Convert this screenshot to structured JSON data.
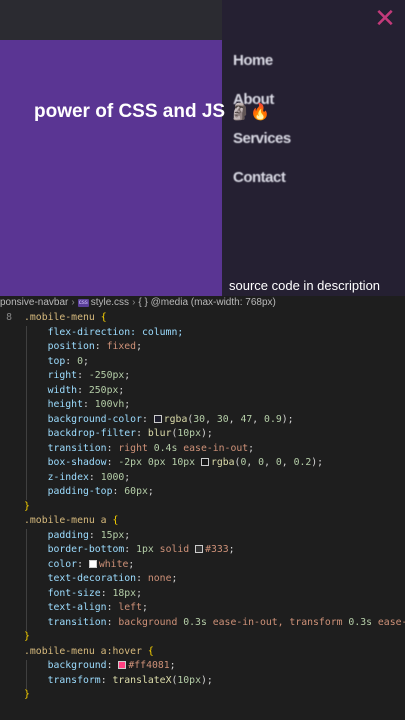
{
  "preview": {
    "menu_items": [
      "Home",
      "About",
      "Services",
      "Contact"
    ],
    "close_glyph": "✕",
    "caption": "power of CSS and JS",
    "caption_emojis": [
      "🗿",
      "🔥"
    ],
    "source_note": "source code in description"
  },
  "breadcrumb": {
    "folder": "ponsive-navbar",
    "file_badge": "css",
    "file": "style.css",
    "symbol": "{ } @media (max-width: 768px)"
  },
  "colors": {
    "purple_panel": "#5a3593",
    "menu_panel": "#252032",
    "close_icon": "#c33a7a"
  },
  "code": {
    "line_number_glyph": "8",
    "lines": [
      [
        {
          "t": ".mobile-menu ",
          "c": "sel"
        },
        {
          "t": "{",
          "c": "brace"
        }
      ],
      [
        {
          "t": "    flex-direction: column;",
          "c": "prop"
        }
      ],
      [
        {
          "t": "    position",
          "c": "prop"
        },
        {
          "t": ": ",
          "c": "punc"
        },
        {
          "t": "fixed",
          "c": "val"
        },
        {
          "t": ";",
          "c": "punc"
        }
      ],
      [
        {
          "t": "    top",
          "c": "prop"
        },
        {
          "t": ": ",
          "c": "punc"
        },
        {
          "t": "0",
          "c": "num"
        },
        {
          "t": ";",
          "c": "punc"
        }
      ],
      [
        {
          "t": "    right",
          "c": "prop"
        },
        {
          "t": ": ",
          "c": "punc"
        },
        {
          "t": "-250px",
          "c": "num"
        },
        {
          "t": ";",
          "c": "punc"
        }
      ],
      [
        {
          "t": "    width",
          "c": "prop"
        },
        {
          "t": ": ",
          "c": "punc"
        },
        {
          "t": "250px",
          "c": "num"
        },
        {
          "t": ";",
          "c": "punc"
        }
      ],
      [
        {
          "t": "    height",
          "c": "prop"
        },
        {
          "t": ": ",
          "c": "punc"
        },
        {
          "t": "100vh",
          "c": "num"
        },
        {
          "t": ";",
          "c": "punc"
        }
      ],
      [
        {
          "t": "    background-color",
          "c": "prop"
        },
        {
          "t": ": ",
          "c": "punc"
        },
        {
          "sw": "rgba(30,30,47,0.9)"
        },
        {
          "t": "rgba",
          "c": "fn"
        },
        {
          "t": "(",
          "c": "punc"
        },
        {
          "t": "30",
          "c": "num"
        },
        {
          "t": ", ",
          "c": "punc"
        },
        {
          "t": "30",
          "c": "num"
        },
        {
          "t": ", ",
          "c": "punc"
        },
        {
          "t": "47",
          "c": "num"
        },
        {
          "t": ", ",
          "c": "punc"
        },
        {
          "t": "0.9",
          "c": "num"
        },
        {
          "t": ");",
          "c": "punc"
        }
      ],
      [
        {
          "t": "    backdrop-filter",
          "c": "prop"
        },
        {
          "t": ": ",
          "c": "punc"
        },
        {
          "t": "blur",
          "c": "fn"
        },
        {
          "t": "(",
          "c": "punc"
        },
        {
          "t": "10px",
          "c": "num"
        },
        {
          "t": ");",
          "c": "punc"
        }
      ],
      [
        {
          "t": "    transition",
          "c": "prop"
        },
        {
          "t": ": ",
          "c": "punc"
        },
        {
          "t": "right ",
          "c": "val"
        },
        {
          "t": "0.4s",
          "c": "num"
        },
        {
          "t": " ease-in-out",
          "c": "val"
        },
        {
          "t": ";",
          "c": "punc"
        }
      ],
      [
        {
          "t": "    box-shadow",
          "c": "prop"
        },
        {
          "t": ": ",
          "c": "punc"
        },
        {
          "t": "-2px 0px 10px ",
          "c": "num"
        },
        {
          "sw": "rgba(0,0,0,0.2)"
        },
        {
          "t": "rgba",
          "c": "fn"
        },
        {
          "t": "(",
          "c": "punc"
        },
        {
          "t": "0",
          "c": "num"
        },
        {
          "t": ", ",
          "c": "punc"
        },
        {
          "t": "0",
          "c": "num"
        },
        {
          "t": ", ",
          "c": "punc"
        },
        {
          "t": "0",
          "c": "num"
        },
        {
          "t": ", ",
          "c": "punc"
        },
        {
          "t": "0.2",
          "c": "num"
        },
        {
          "t": ");",
          "c": "punc"
        }
      ],
      [
        {
          "t": "    z-index",
          "c": "prop"
        },
        {
          "t": ": ",
          "c": "punc"
        },
        {
          "t": "1000",
          "c": "num"
        },
        {
          "t": ";",
          "c": "punc"
        }
      ],
      [
        {
          "t": "    padding-top",
          "c": "prop"
        },
        {
          "t": ": ",
          "c": "punc"
        },
        {
          "t": "60px",
          "c": "num"
        },
        {
          "t": ";",
          "c": "punc"
        }
      ],
      [
        {
          "t": "}",
          "c": "brace"
        }
      ],
      [
        {
          "t": ".mobile-menu a ",
          "c": "sel"
        },
        {
          "t": "{",
          "c": "brace"
        }
      ],
      [
        {
          "t": "    padding",
          "c": "prop"
        },
        {
          "t": ": ",
          "c": "punc"
        },
        {
          "t": "15px",
          "c": "num"
        },
        {
          "t": ";",
          "c": "punc"
        }
      ],
      [
        {
          "t": "    border-bottom",
          "c": "prop"
        },
        {
          "t": ": ",
          "c": "punc"
        },
        {
          "t": "1px",
          "c": "num"
        },
        {
          "t": " solid ",
          "c": "val"
        },
        {
          "sw": "#333333"
        },
        {
          "t": "#333",
          "c": "val"
        },
        {
          "t": ";",
          "c": "punc"
        }
      ],
      [
        {
          "t": "    color",
          "c": "prop"
        },
        {
          "t": ": ",
          "c": "punc"
        },
        {
          "sw": "#ffffff"
        },
        {
          "t": "white",
          "c": "val"
        },
        {
          "t": ";",
          "c": "punc"
        }
      ],
      [
        {
          "t": "    text-decoration",
          "c": "prop"
        },
        {
          "t": ": ",
          "c": "punc"
        },
        {
          "t": "none",
          "c": "val"
        },
        {
          "t": ";",
          "c": "punc"
        }
      ],
      [
        {
          "t": "    font-size",
          "c": "prop"
        },
        {
          "t": ": ",
          "c": "punc"
        },
        {
          "t": "18px",
          "c": "num"
        },
        {
          "t": ";",
          "c": "punc"
        }
      ],
      [
        {
          "t": "    text-align",
          "c": "prop"
        },
        {
          "t": ": ",
          "c": "punc"
        },
        {
          "t": "left",
          "c": "val"
        },
        {
          "t": ";",
          "c": "punc"
        }
      ],
      [
        {
          "t": "    transition",
          "c": "prop"
        },
        {
          "t": ": ",
          "c": "punc"
        },
        {
          "t": "background ",
          "c": "val"
        },
        {
          "t": "0.3s",
          "c": "num"
        },
        {
          "t": " ease-in-out, transform ",
          "c": "val"
        },
        {
          "t": "0.3s",
          "c": "num"
        },
        {
          "t": " ease-",
          "c": "val"
        }
      ],
      [
        {
          "t": "}",
          "c": "brace"
        }
      ],
      [
        {
          "t": ".mobile-menu a:hover ",
          "c": "sel"
        },
        {
          "t": "{",
          "c": "brace"
        }
      ],
      [
        {
          "t": "    background",
          "c": "prop"
        },
        {
          "t": ": ",
          "c": "punc"
        },
        {
          "sw": "#ff4081"
        },
        {
          "t": "#ff4081",
          "c": "val"
        },
        {
          "t": ";",
          "c": "punc"
        }
      ],
      [
        {
          "t": "    transform",
          "c": "prop"
        },
        {
          "t": ": ",
          "c": "punc"
        },
        {
          "t": "translateX",
          "c": "fn"
        },
        {
          "t": "(",
          "c": "punc"
        },
        {
          "t": "10px",
          "c": "num"
        },
        {
          "t": ");",
          "c": "punc"
        }
      ],
      [
        {
          "t": "}",
          "c": "brace"
        }
      ]
    ]
  }
}
